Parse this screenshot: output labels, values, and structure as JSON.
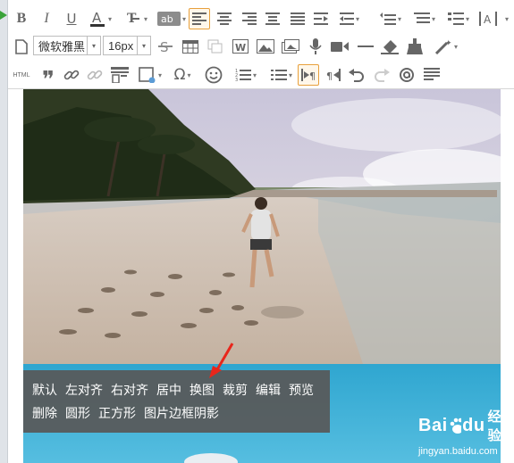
{
  "toolbar": {
    "font_family_value": "微软雅黑",
    "font_size_value": "16px",
    "html_label": "HTML",
    "text_color_accent": "#333333",
    "active_border_color": "#e8a03c"
  },
  "image_menu": {
    "row1": [
      "默认",
      "左对齐",
      "右对齐",
      "居中",
      "换图",
      "裁剪",
      "编辑",
      "预览"
    ],
    "row2": [
      "删除",
      "圆形",
      "正方形",
      "图片边框阴影"
    ]
  },
  "watermark": {
    "brand_left": "Bai",
    "brand_right": "du",
    "brand_cn": "经验",
    "url": "jingyan.baidu.com"
  },
  "colors": {
    "annotation_arrow": "#e8261b",
    "popup_bg": "#585858"
  }
}
